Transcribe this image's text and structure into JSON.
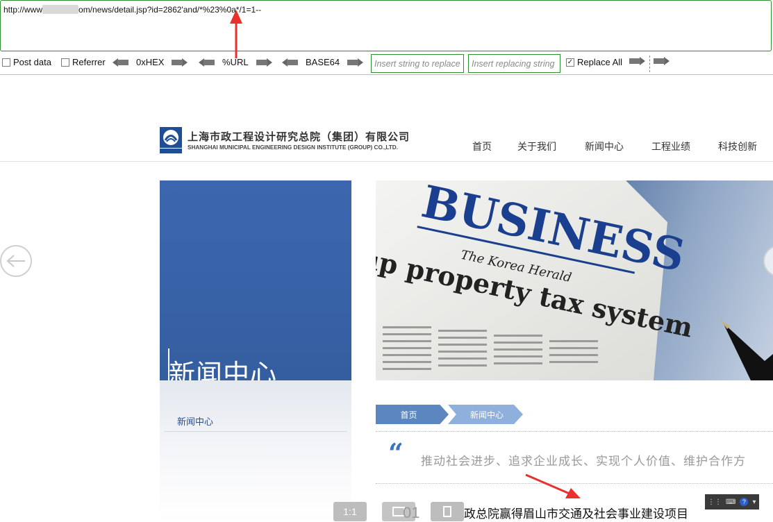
{
  "hackbar": {
    "url_prefix": "http://www",
    "url_suffix": "om/news/detail.jsp?id=2862'and/*%23%0a*/1=1--",
    "post_data_label": "Post data",
    "referrer_label": "Referrer",
    "hex_label": "0xHEX",
    "url_label": "%URL",
    "base64_label": "BASE64",
    "replace_find_placeholder": "Insert string to replace",
    "replace_with_placeholder": "Insert replacing string",
    "replace_all_label": "Replace All",
    "replace_all_checked": true,
    "accent_color": "#2e8b2e"
  },
  "site": {
    "logo_cn": "上海市政工程设计研究总院（集团）有限公司",
    "logo_en": "SHANGHAI MUNICIPAL ENGINEERING DESIGN INSTITUTE (GROUP) CO.,LTD.",
    "logo_mark": "SMEDI",
    "nav": [
      "首页",
      "关于我们",
      "新闻中心",
      "工程业绩",
      "科技创新"
    ]
  },
  "content": {
    "panel_title": "新闻中心",
    "side_link": "新闻中心",
    "breadcrumb": [
      "首页",
      "新闻中心"
    ],
    "slogan": "推动社会进步、追求企业成长、实现个人价值、维护合作方",
    "news_title": "市政总院赢得眉山市交通及社会事业建设项目",
    "banner_headline": "BUSINESS",
    "banner_masthead": "The Korea Herald",
    "banner_subhead": "up property tax system"
  },
  "viewer": {
    "btn_one_to_one": "1:1",
    "btn_fit": "01"
  },
  "colors": {
    "panel_blue": "#3a64aa",
    "crumb_dark": "#5b86c0",
    "crumb_light": "#8fb0dc",
    "annotation_red": "#e8302c"
  }
}
